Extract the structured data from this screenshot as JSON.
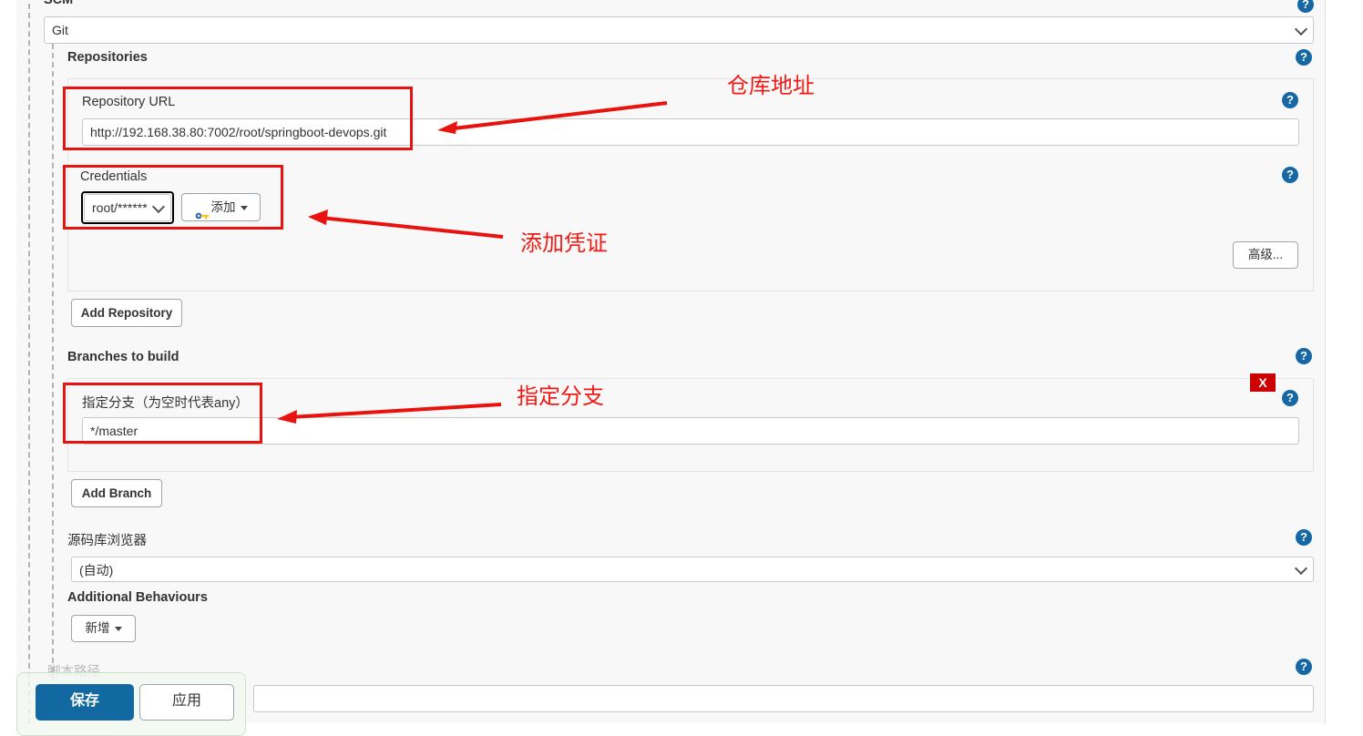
{
  "form": {
    "scm_label": "SCM",
    "scm_select_value": "Git",
    "repositories_label": "Repositories",
    "repository_url_label": "Repository URL",
    "repository_url_value": "http://192.168.38.80:7002/root/springboot-devops.git",
    "credentials_label": "Credentials",
    "credentials_select_value": "root/******",
    "credentials_add_label": "添加",
    "advanced_button": "高级...",
    "add_repository_button": "Add Repository",
    "branches_label": "Branches to build",
    "branch_specifier_label": "指定分支（为空时代表any）",
    "branch_specifier_value": "*/master",
    "delete_branch_button": "X",
    "add_branch_button": "Add Branch",
    "repo_browser_label": "源码库浏览器",
    "repo_browser_value": "(自动)",
    "additional_behaviours_label": "Additional Behaviours",
    "additional_add_button": "新增",
    "script_path_label": "脚本路径"
  },
  "savebar": {
    "save_label": "保存",
    "apply_label": "应用"
  },
  "annotations": [
    {
      "text": "仓库地址"
    },
    {
      "text": "添加凭证"
    },
    {
      "text": "指定分支"
    }
  ],
  "icons": {
    "help": "?",
    "key": "key-icon",
    "caret_down": "chevron-down-icon"
  },
  "colors": {
    "accent_blue": "#1268a0",
    "help_blue": "#1668a5",
    "annotation_red": "#f01a16",
    "highlight_red": "#e8130f",
    "delete_red": "#cc0000",
    "page_bg": "#f8f8f8"
  }
}
